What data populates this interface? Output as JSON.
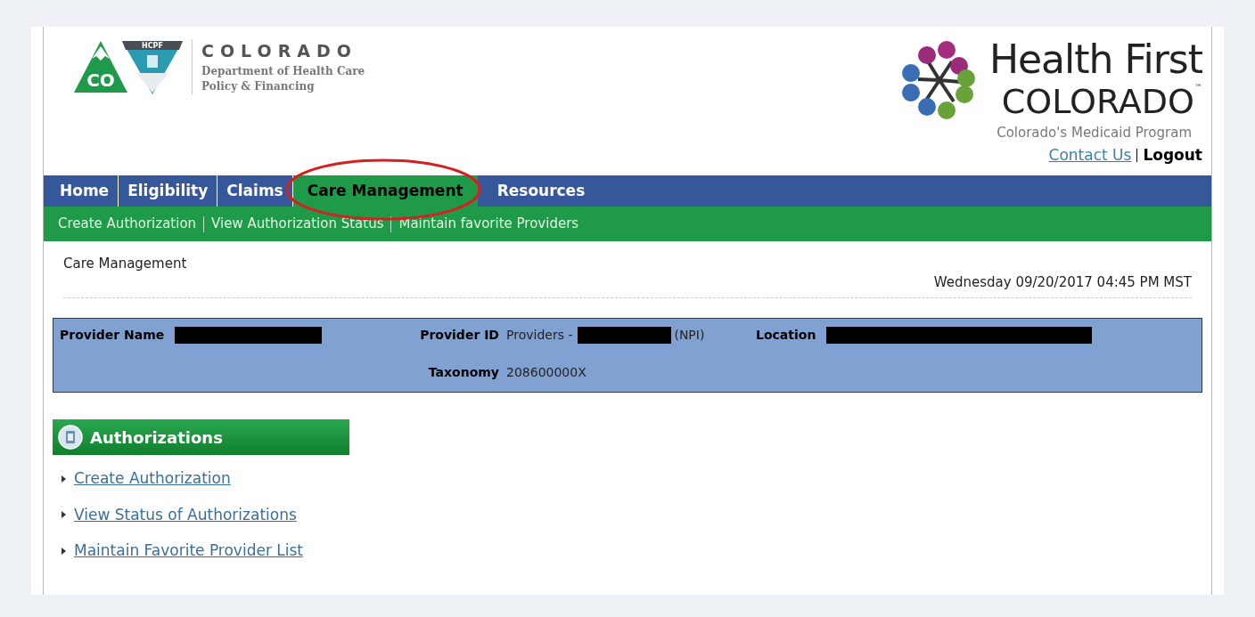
{
  "header": {
    "state_logo": {
      "badge": "CO",
      "shield": "HCPF",
      "name": "COLORADO",
      "department": "Department of Health Care Policy & Financing"
    },
    "program_logo": {
      "line_1": "Health First",
      "line_2": "COLORADO",
      "trademark": "™",
      "tagline": "Colorado's Medicaid Program"
    },
    "links": [
      {
        "label": "Contact Us",
        "kind": "link"
      },
      {
        "label": "Logout",
        "kind": "bold"
      }
    ]
  },
  "nav": {
    "tabs": [
      {
        "label": "Home",
        "selected": false,
        "circled": false
      },
      {
        "label": "Eligibility",
        "selected": false,
        "circled": false
      },
      {
        "label": "Claims",
        "selected": false,
        "circled": false
      },
      {
        "label": "Care Management",
        "selected": true,
        "circled": true
      },
      {
        "label": "Resources",
        "selected": false,
        "circled": false
      }
    ],
    "sub_links": [
      "Create Authorization",
      "View Authorization Status",
      "Maintain favorite Providers"
    ]
  },
  "page": {
    "title": "Care Management",
    "timestamp": "Wednesday 09/20/2017 04:45 PM MST"
  },
  "provider": {
    "name": {
      "label": "Provider Name",
      "redacted": true
    },
    "id": {
      "label": "Provider ID",
      "prefix": "Providers -",
      "redacted": true,
      "suffix": "(NPI)"
    },
    "location": {
      "label": "Location",
      "redacted": true
    },
    "taxonomy": {
      "label": "Taxonomy",
      "value": "208600000X"
    }
  },
  "authorizations": {
    "title": "Authorizations",
    "links": [
      "Create Authorization",
      "View Status of Authorizations",
      "Maintain Favorite Provider List"
    ]
  }
}
